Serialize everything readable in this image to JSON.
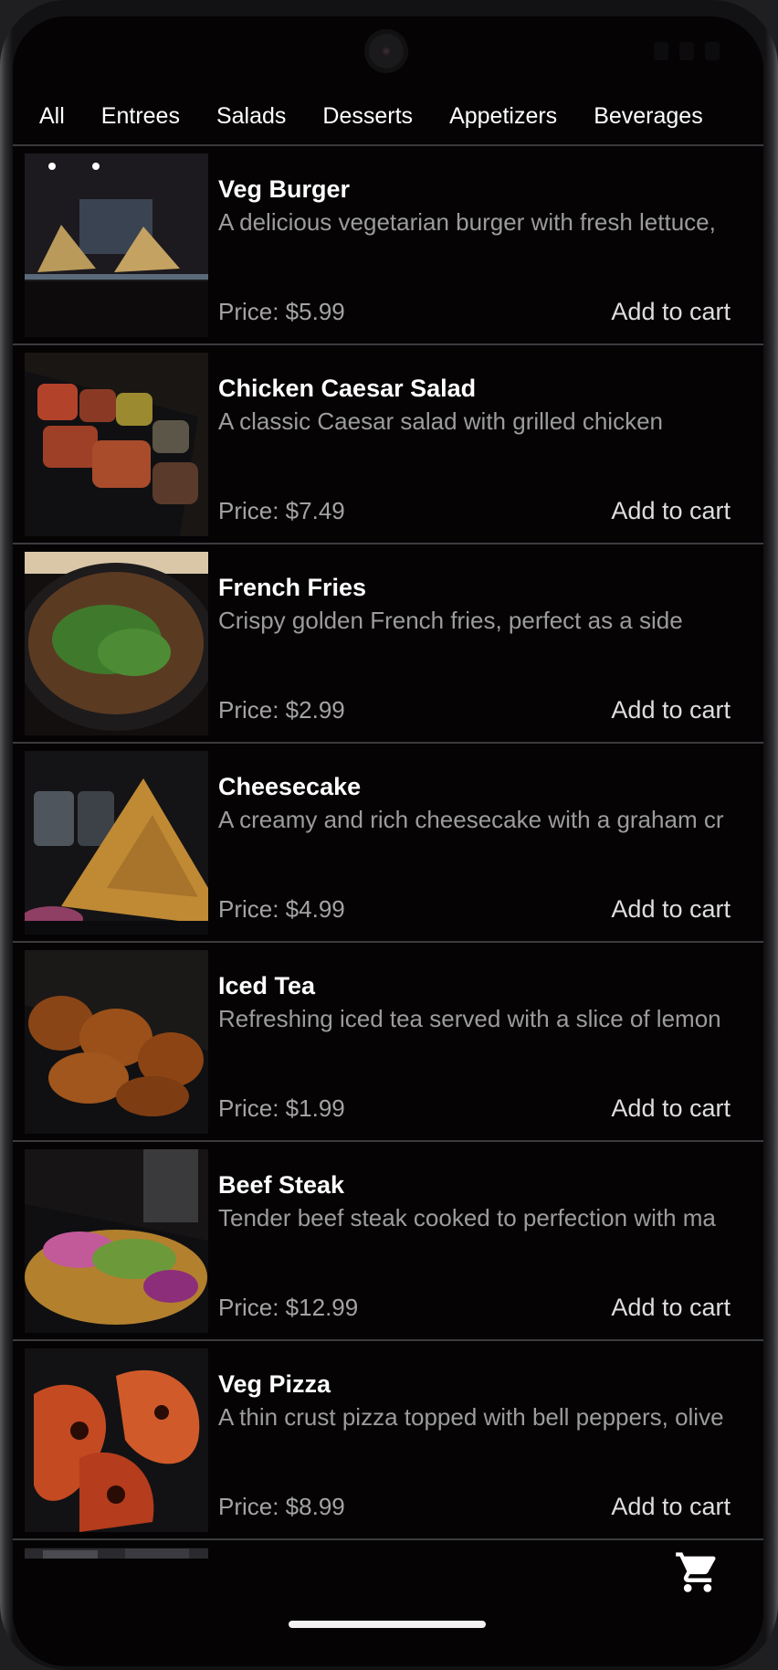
{
  "tabs": [
    "All",
    "Entrees",
    "Salads",
    "Desserts",
    "Appetizers",
    "Beverages"
  ],
  "items": [
    {
      "name": "Veg Burger",
      "description": "A delicious vegetarian burger with fresh lettuce,",
      "price": "Price: $5.99",
      "cta": "Add to cart"
    },
    {
      "name": "Chicken Caesar Salad",
      "description": "A classic Caesar salad with grilled chicken",
      "price": "Price: $7.49",
      "cta": "Add to cart"
    },
    {
      "name": "French Fries",
      "description": "Crispy golden French fries, perfect as a side",
      "price": "Price: $2.99",
      "cta": "Add to cart"
    },
    {
      "name": "Cheesecake",
      "description": "A creamy and rich cheesecake with a graham cr",
      "price": "Price: $4.99",
      "cta": "Add to cart"
    },
    {
      "name": "Iced Tea",
      "description": "Refreshing iced tea served with a slice of lemon",
      "price": "Price: $1.99",
      "cta": "Add to cart"
    },
    {
      "name": "Beef Steak",
      "description": "Tender beef steak cooked to perfection with ma",
      "price": "Price: $12.99",
      "cta": "Add to cart"
    },
    {
      "name": "Veg Pizza",
      "description": "A thin crust pizza topped with bell peppers, olive",
      "price": "Price: $8.99",
      "cta": "Add to cart"
    }
  ],
  "cart_icon": "shopping-cart-icon",
  "colors": {
    "background": "#050304",
    "text": "#ffffff",
    "muted": "#9c9c9c",
    "divider": "#3c3c3f"
  }
}
